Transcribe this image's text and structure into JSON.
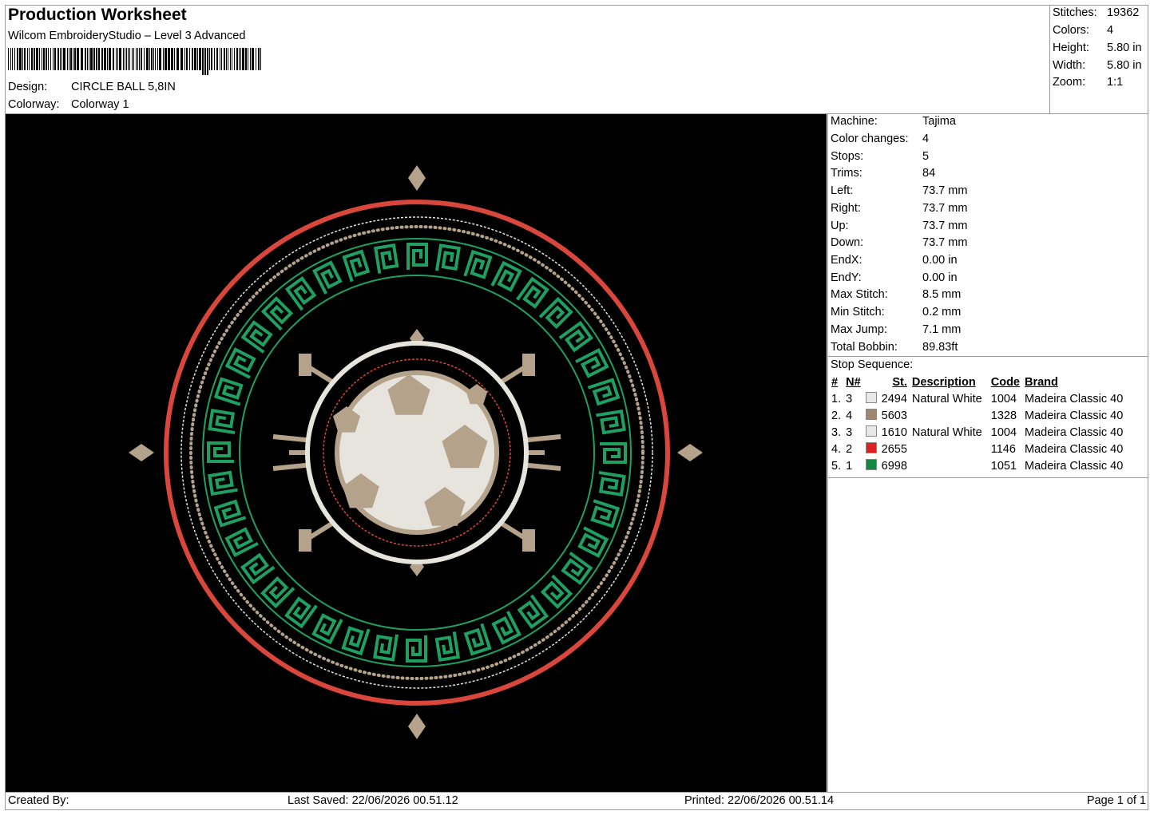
{
  "header": {
    "title": "Production Worksheet",
    "software": "Wilcom EmbroideryStudio – Level 3 Advanced",
    "design_label": "Design:",
    "design_value": "CIRCLE BALL 5,8IN",
    "colorway_label": "Colorway:",
    "colorway_value": "Colorway 1"
  },
  "stats": [
    {
      "label": "Stitches:",
      "value": "19362"
    },
    {
      "label": "Colors:",
      "value": "4"
    },
    {
      "label": "Height:",
      "value": "5.80 in"
    },
    {
      "label": "Width:",
      "value": "5.80 in"
    },
    {
      "label": "Zoom:",
      "value": "1:1"
    }
  ],
  "machine_info": [
    {
      "label": "Machine:",
      "value": "Tajima"
    },
    {
      "label": "Color changes:",
      "value": "4"
    },
    {
      "label": "Stops:",
      "value": "5"
    },
    {
      "label": "Trims:",
      "value": "84"
    },
    {
      "label": "Left:",
      "value": "73.7 mm"
    },
    {
      "label": "Right:",
      "value": "73.7 mm"
    },
    {
      "label": "Up:",
      "value": "73.7 mm"
    },
    {
      "label": "Down:",
      "value": "73.7 mm"
    },
    {
      "label": "EndX:",
      "value": "0.00 in"
    },
    {
      "label": "EndY:",
      "value": "0.00 in"
    },
    {
      "label": "Max Stitch:",
      "value": "8.5 mm"
    },
    {
      "label": "Min Stitch:",
      "value": "0.2 mm"
    },
    {
      "label": "Max Jump:",
      "value": "7.1 mm"
    },
    {
      "label": "Total Bobbin:",
      "value": "89.83ft"
    }
  ],
  "stop_sequence": {
    "title": "Stop Sequence:",
    "columns": [
      "#",
      "N#",
      "St.",
      "Description",
      "Code",
      "Brand"
    ],
    "rows": [
      {
        "idx": "1.",
        "n": "3",
        "color": "#e8e8ea",
        "st": "2494",
        "desc": "Natural White",
        "code": "1004",
        "brand": "Madeira Classic 40"
      },
      {
        "idx": "2.",
        "n": "4",
        "color": "#a08870",
        "st": "5603",
        "desc": "",
        "code": "1328",
        "brand": "Madeira Classic 40"
      },
      {
        "idx": "3.",
        "n": "3",
        "color": "#e8e8ea",
        "st": "1610",
        "desc": "Natural White",
        "code": "1004",
        "brand": "Madeira Classic 40"
      },
      {
        "idx": "4.",
        "n": "2",
        "color": "#dd2222",
        "st": "2655",
        "desc": "",
        "code": "1146",
        "brand": "Madeira Classic 40"
      },
      {
        "idx": "5.",
        "n": "1",
        "color": "#108a40",
        "st": "6998",
        "desc": "",
        "code": "1051",
        "brand": "Madeira Classic 40"
      }
    ]
  },
  "footer": {
    "created_by": "Created By:",
    "last_saved": "Last Saved: 22/06/2026 00.51.12",
    "printed": "Printed: 22/06/2026 00.51.14",
    "page": "Page 1 of 1"
  },
  "design_colors": {
    "background": "#000000",
    "red": "#d9463c",
    "white": "#e6e4dc",
    "tan": "#b5a28a",
    "green": "#1fa060"
  }
}
